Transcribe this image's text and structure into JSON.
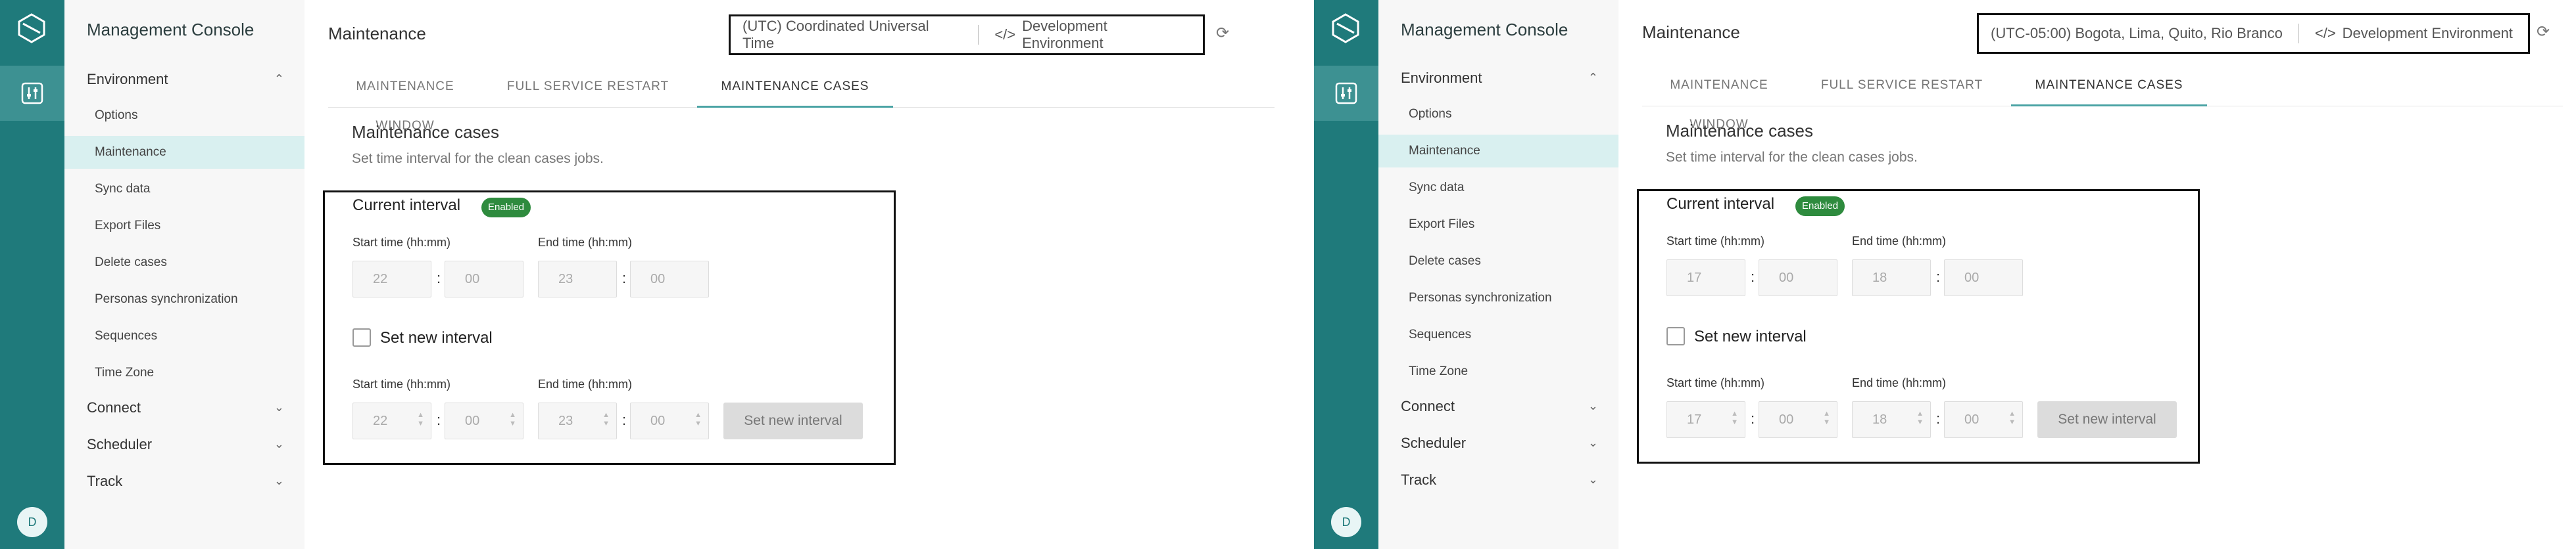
{
  "panels": [
    {
      "nav": {
        "title": "Management Console",
        "environment": "Environment",
        "items": [
          "Options",
          "Maintenance",
          "Sync data",
          "Export Files",
          "Delete cases",
          "Personas synchronization",
          "Sequences",
          "Time Zone"
        ],
        "groups": [
          "Connect",
          "Scheduler",
          "Track"
        ],
        "avatar": "D"
      },
      "header": {
        "title": "Maintenance",
        "timezone": "(UTC) Coordinated Universal Time",
        "environment_icon": "</>",
        "environment": "Development Environment",
        "refresh_icon": "⟳"
      },
      "tabs": [
        "MAINTENANCE WINDOW",
        "FULL SERVICE RESTART",
        "MAINTENANCE CASES"
      ],
      "section": {
        "title": "Maintenance cases",
        "description": "Set time interval for the clean cases jobs."
      },
      "current": {
        "title": "Current interval",
        "badge": "Enabled",
        "start_label": "Start time (hh:mm)",
        "end_label": "End time (hh:mm)",
        "start_h": "22",
        "start_m": "00",
        "end_h": "23",
        "end_m": "00"
      },
      "new": {
        "checkbox_label": "Set new interval",
        "start_label": "Start time (hh:mm)",
        "end_label": "End time (hh:mm)",
        "start_h": "22",
        "start_m": "00",
        "end_h": "23",
        "end_m": "00",
        "button": "Set new interval"
      }
    },
    {
      "nav": {
        "title": "Management Console",
        "environment": "Environment",
        "items": [
          "Options",
          "Maintenance",
          "Sync data",
          "Export Files",
          "Delete cases",
          "Personas synchronization",
          "Sequences",
          "Time Zone"
        ],
        "groups": [
          "Connect",
          "Scheduler",
          "Track"
        ],
        "avatar": "D"
      },
      "header": {
        "title": "Maintenance",
        "timezone": "(UTC-05:00) Bogota, Lima, Quito, Rio Branco",
        "environment_icon": "</>",
        "environment": "Development Environment",
        "refresh_icon": "⟳"
      },
      "tabs": [
        "MAINTENANCE WINDOW",
        "FULL SERVICE RESTART",
        "MAINTENANCE CASES"
      ],
      "section": {
        "title": "Maintenance cases",
        "description": "Set time interval for the clean cases jobs."
      },
      "current": {
        "title": "Current interval",
        "badge": "Enabled",
        "start_label": "Start time (hh:mm)",
        "end_label": "End time (hh:mm)",
        "start_h": "17",
        "start_m": "00",
        "end_h": "18",
        "end_m": "00"
      },
      "new": {
        "checkbox_label": "Set new interval",
        "start_label": "Start time (hh:mm)",
        "end_label": "End time (hh:mm)",
        "start_h": "17",
        "start_m": "00",
        "end_h": "18",
        "end_m": "00",
        "button": "Set new interval"
      }
    }
  ],
  "colors": {
    "rail": "#1f7a7b",
    "active_nav": "#d9f0f0",
    "badge": "#2e8b3e",
    "tab_underline": "#4aa3a4"
  }
}
